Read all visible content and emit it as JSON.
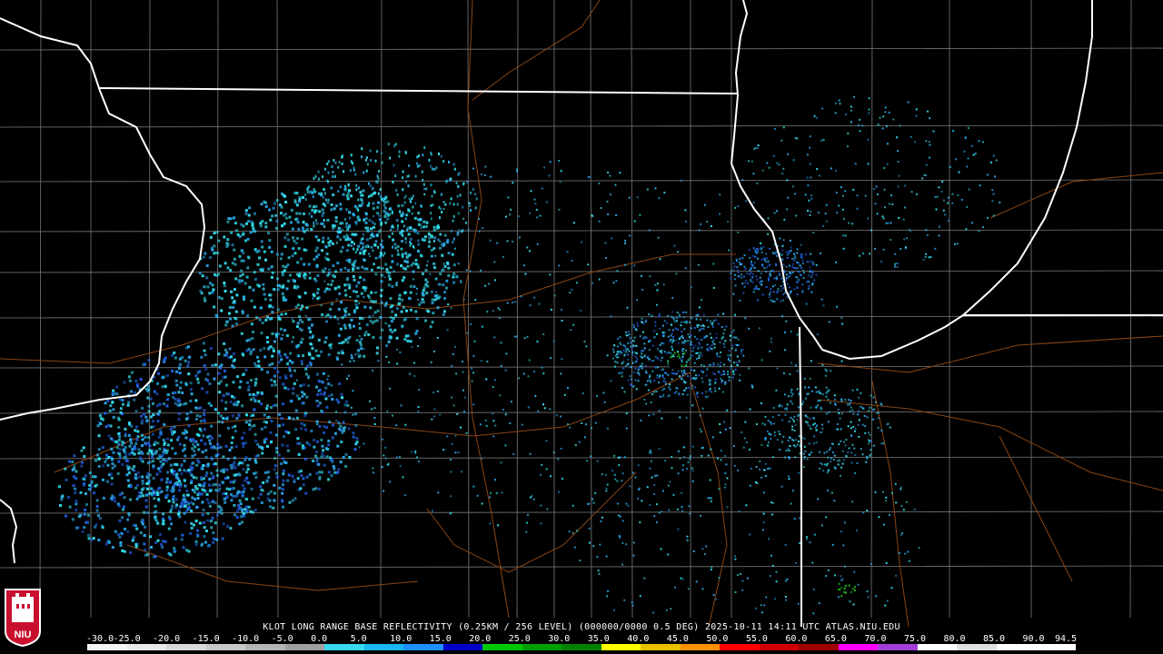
{
  "caption": {
    "radar": "KLOT",
    "text": "KLOT LONG RANGE BASE REFLECTIVITY (0.25KM / 256 LEVEL) (000000/0000 0.5 DEG) 2025-10-11 14:11 UTC  ATLAS.NIU.EDU"
  },
  "logo": {
    "text": "NIU"
  },
  "scale": {
    "labels": [
      "-30.0",
      "-25.0",
      "-20.0",
      "-15.0",
      "-10.0",
      "-5.0",
      "0.0",
      "5.0",
      "10.0",
      "15.0",
      "20.0",
      "25.0",
      "30.0",
      "35.0",
      "40.0",
      "45.0",
      "50.0",
      "55.0",
      "60.0",
      "65.0",
      "70.0",
      "75.0",
      "80.0",
      "85.0",
      "90.0",
      "94.5"
    ],
    "min": -30.0,
    "max": 94.5,
    "colors": [
      "#f4f4f4",
      "#e8e8e8",
      "#d8d8d8",
      "#c8c8c8",
      "#b4b4b4",
      "#a0a0a0",
      "#38d8f0",
      "#18b8f0",
      "#1e90ff",
      "#0000c8",
      "#00c800",
      "#00a000",
      "#008000",
      "#ffff00",
      "#e8c000",
      "#ff9000",
      "#ff0000",
      "#d00000",
      "#a00000",
      "#ff00ff",
      "#a040d8",
      "#ffffff",
      "#e0e0e0",
      "#ffffff",
      "#ffffff"
    ]
  },
  "map_colors": {
    "background": "#000000",
    "state_borders": "#ffffff",
    "county_lines": "#7a7a7a",
    "highways": "#8b4513",
    "echo_light": "#33e0f0",
    "echo_mid": "#2aa8e8",
    "echo_dark": "#2060e0",
    "echo_green": "#20c020"
  }
}
